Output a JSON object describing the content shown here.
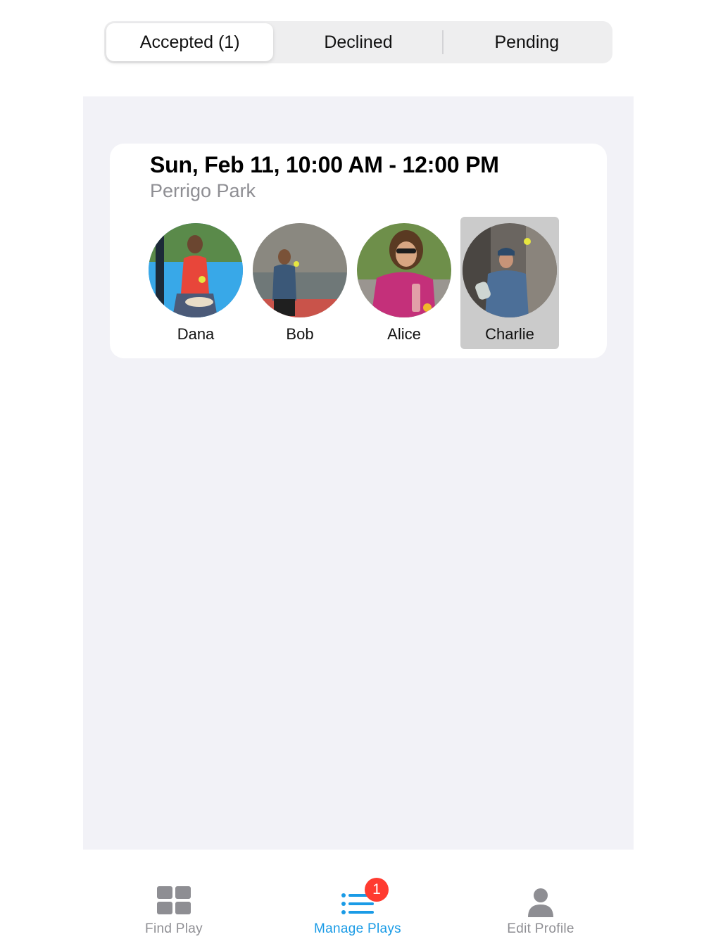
{
  "segments": [
    {
      "label": "Accepted (1)",
      "active": true
    },
    {
      "label": "Declined",
      "active": false
    },
    {
      "label": "Pending",
      "active": false
    }
  ],
  "event": {
    "datetime": "Sun, Feb 11, 10:00 AM - 12:00 PM",
    "location": "Perrigo Park",
    "players": [
      {
        "name": "Dana",
        "selected": false
      },
      {
        "name": "Bob",
        "selected": false
      },
      {
        "name": "Alice",
        "selected": false
      },
      {
        "name": "Charlie",
        "selected": true
      }
    ]
  },
  "tabbar": {
    "items": [
      {
        "label": "Find Play",
        "icon": "grid-icon",
        "active": false
      },
      {
        "label": "Manage Plays",
        "icon": "list-icon",
        "active": true,
        "badge": "1"
      },
      {
        "label": "Edit Profile",
        "icon": "person-icon",
        "active": false
      }
    ]
  },
  "colors": {
    "accent": "#1a9be6",
    "badge": "#ff3b30",
    "panel_bg": "#f2f2f7",
    "selected_bg": "#cbcbcb",
    "inactive": "#8e8e93"
  }
}
